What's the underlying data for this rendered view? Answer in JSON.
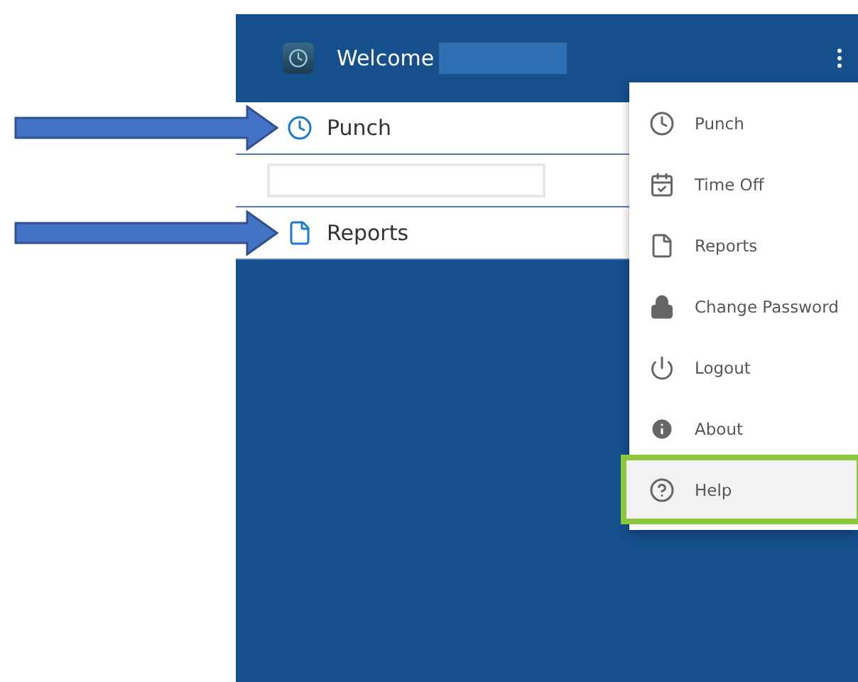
{
  "header": {
    "title": "Welcome"
  },
  "nav": [
    {
      "kind": "clock",
      "label": "Punch",
      "arrow": true
    },
    {
      "kind": "redacted",
      "arrow": false
    },
    {
      "kind": "file",
      "label": "Reports",
      "arrow": true
    }
  ],
  "menu": [
    {
      "kind": "clock",
      "label": "Punch",
      "highlighted": false
    },
    {
      "kind": "calendar",
      "label": "Time Off",
      "highlighted": false
    },
    {
      "kind": "file",
      "label": "Reports",
      "highlighted": false
    },
    {
      "kind": "lock",
      "label": "Change Password",
      "highlighted": false
    },
    {
      "kind": "power",
      "label": "Logout",
      "highlighted": false
    },
    {
      "kind": "info",
      "label": "About",
      "highlighted": false
    },
    {
      "kind": "help",
      "label": "Help",
      "highlighted": true
    }
  ]
}
